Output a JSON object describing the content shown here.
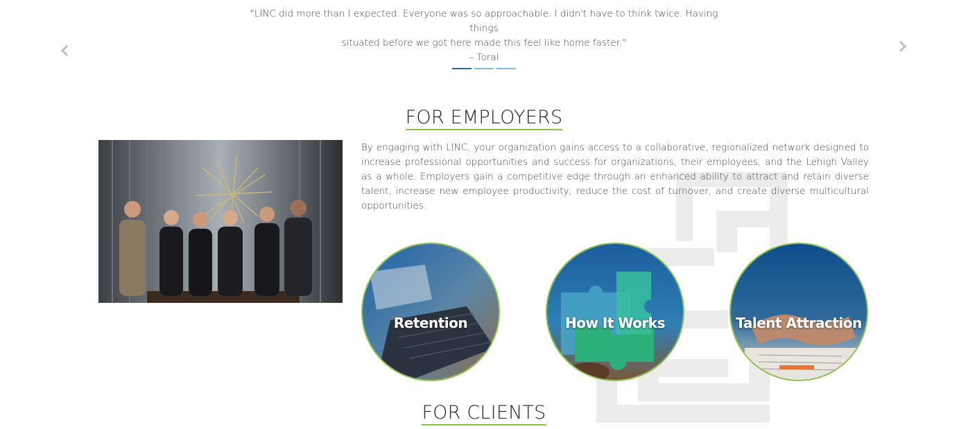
{
  "testimonial": {
    "quote_line1": "\"LINC did more than I expected. Everyone was so approachable. I didn't have to think twice. Having things",
    "quote_line2": "situated before we got here made this feel like home faster.\"",
    "author": "– Toral",
    "prev_icon": "chevron-left-icon",
    "next_icon": "chevron-right-icon",
    "slides": 3,
    "active_slide": 1
  },
  "employers": {
    "heading": "FOR EMPLOYERS",
    "paragraph": "By engaging with LINC, your organization gains access to a collaborative, regionalized network designed to increase professional opportunities and success for organizations, their employees, and the Lehigh Valley as a whole. Employers gain a competitive edge through an enhanced ability to attract and retain diverse talent, increase new employee productivity, reduce the cost of turnover, and create diverse multicultural opportunities.",
    "circles": [
      {
        "label": "Retention"
      },
      {
        "label": "How It Works"
      },
      {
        "label": "Talent Attraction"
      }
    ]
  },
  "clients": {
    "heading": "FOR CLIENTS"
  },
  "colors": {
    "accent_green": "#8bc34a",
    "dot_active": "#2168a8",
    "dot_inactive": "#8ab4d6",
    "text": "#444444"
  }
}
